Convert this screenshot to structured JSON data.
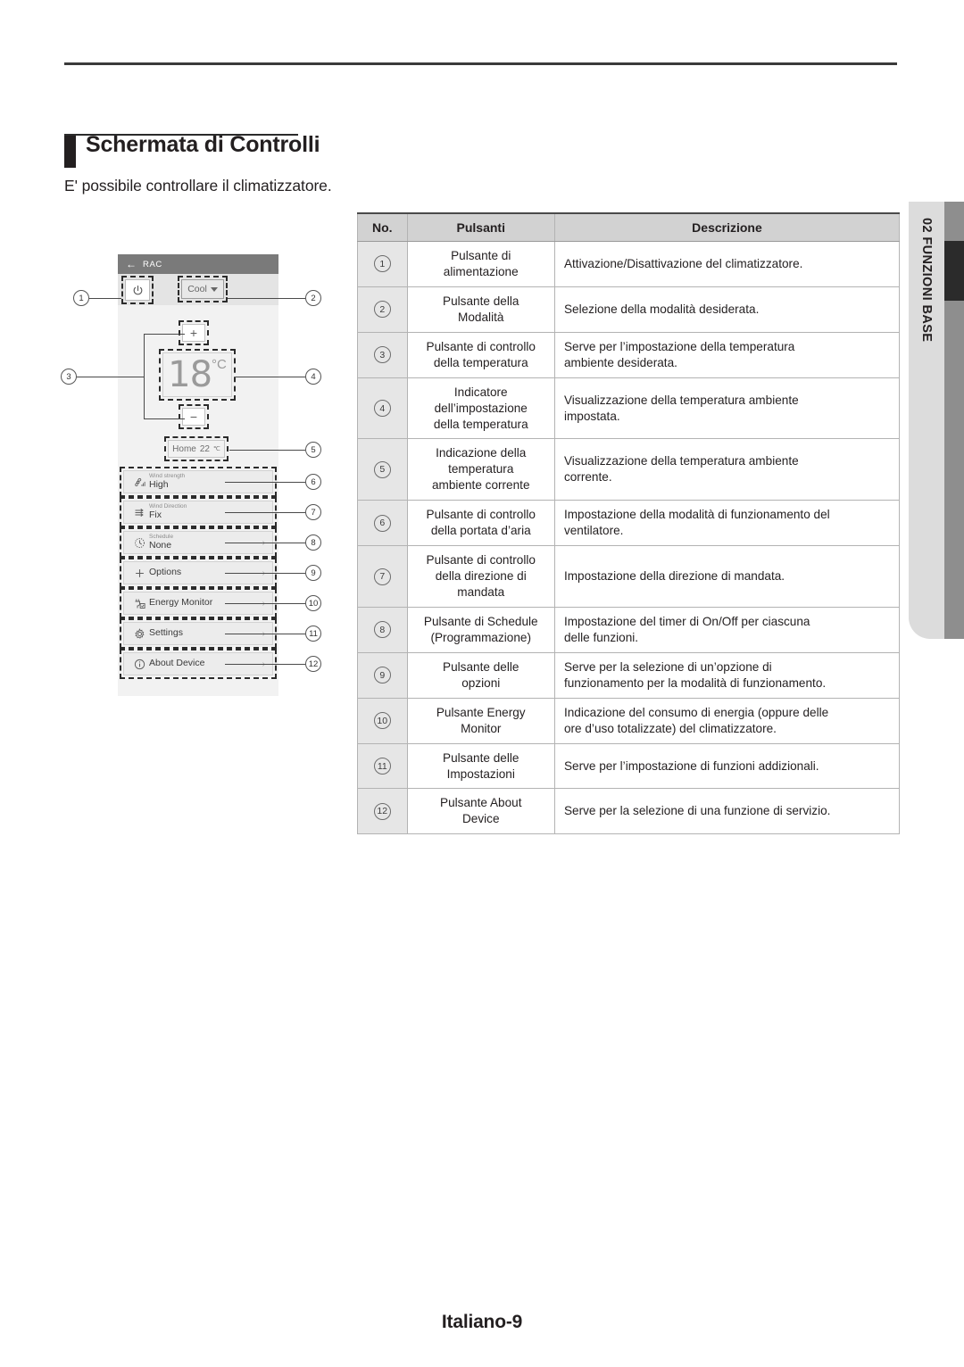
{
  "page": {
    "heading": "Schermata di Controlli",
    "subtitle": "E' possibile  controllare il climatizzatore.",
    "footer": "Italiano-9"
  },
  "side_tab": {
    "label": "02  FUNZIONI BASE"
  },
  "device": {
    "titlebar": {
      "back_icon": "back-arrow-icon",
      "title": "RAC"
    },
    "power_button": {
      "icon": "power-icon"
    },
    "mode_button": {
      "label": "Cool",
      "icon": "chevron-down-icon"
    },
    "plus_button": "+",
    "minus_button": "−",
    "set_temperature": "18",
    "set_temperature_unit": "°C",
    "home_chip": {
      "label": "Home",
      "value": "22",
      "unit": "℃"
    },
    "menu": [
      {
        "icon": "fan-icon",
        "label": "Wind strength",
        "value": "High",
        "chevron": ""
      },
      {
        "icon": "airflow-icon",
        "label": "Wind Direction",
        "value": "Fix",
        "chevron": ""
      },
      {
        "icon": "clock-icon",
        "label": "Schedule",
        "value": "None",
        "chevron": "›"
      },
      {
        "icon": "plus-icon",
        "label": "",
        "value": "Options",
        "chevron": "›"
      },
      {
        "icon": "energy-plug-icon",
        "label": "",
        "value": "Energy Monitor",
        "chevron": "›"
      },
      {
        "icon": "gear-icon",
        "label": "",
        "value": "Settings",
        "chevron": "›"
      },
      {
        "icon": "info-icon",
        "label": "",
        "value": "About Device",
        "chevron": "›"
      }
    ],
    "callouts": [
      "1",
      "2",
      "3",
      "4",
      "5",
      "6",
      "7",
      "8",
      "9",
      "10",
      "11",
      "12"
    ]
  },
  "table": {
    "headers": [
      "No.",
      "Pulsanti",
      "Descrizione"
    ],
    "rows": [
      {
        "no": "1",
        "button": "Pulsante di\nalimentazione",
        "desc": "Attivazione/Disattivazione del climatizzatore."
      },
      {
        "no": "2",
        "button": "Pulsante della\nModalità",
        "desc": "Selezione della modalità desiderata."
      },
      {
        "no": "3",
        "button": "Pulsante di controllo\ndella temperatura",
        "desc": "Serve per l’impostazione della temperatura\nambiente desiderata."
      },
      {
        "no": "4",
        "button": "Indicatore\ndell’impostazione\ndella temperatura",
        "desc": "Visualizzazione della temperatura ambiente\nimpostata."
      },
      {
        "no": "5",
        "button": "Indicazione della\ntemperatura\nambiente corrente",
        "desc": "Visualizzazione della temperatura ambiente\ncorrente."
      },
      {
        "no": "6",
        "button": "Pulsante di controllo\ndella portata d’aria",
        "desc": "Impostazione della modalità di funzionamento del\nventilatore."
      },
      {
        "no": "7",
        "button": "Pulsante di controllo\ndella direzione di\nmandata",
        "desc": "Impostazione della direzione di mandata."
      },
      {
        "no": "8",
        "button": "Pulsante di Schedule\n(Programmazione)",
        "desc": "Impostazione del timer di On/Off per ciascuna\ndelle funzioni."
      },
      {
        "no": "9",
        "button": "Pulsante delle\nopzioni",
        "desc": "Serve per la selezione di un’opzione di\nfunzionamento per la modalità di funzionamento."
      },
      {
        "no": "10",
        "button": "Pulsante Energy\nMonitor",
        "desc": "Indicazione del consumo di energia (oppure delle\nore d’uso totalizzate) del climatizzatore."
      },
      {
        "no": "11",
        "button": "Pulsante delle\nImpostazioni",
        "desc": "Serve per l’impostazione di funzioni addizionali."
      },
      {
        "no": "12",
        "button": "Pulsante About\nDevice",
        "desc": "Serve per la selezione di una funzione di servizio."
      }
    ]
  },
  "colors": {
    "header_bg": "#d2d2d2",
    "no_col_bg": "#e6e6e6",
    "side_tab": "#dcdcdc",
    "side_strip": "#8e8e8e",
    "side_strip_dark": "#2b2b2b"
  }
}
